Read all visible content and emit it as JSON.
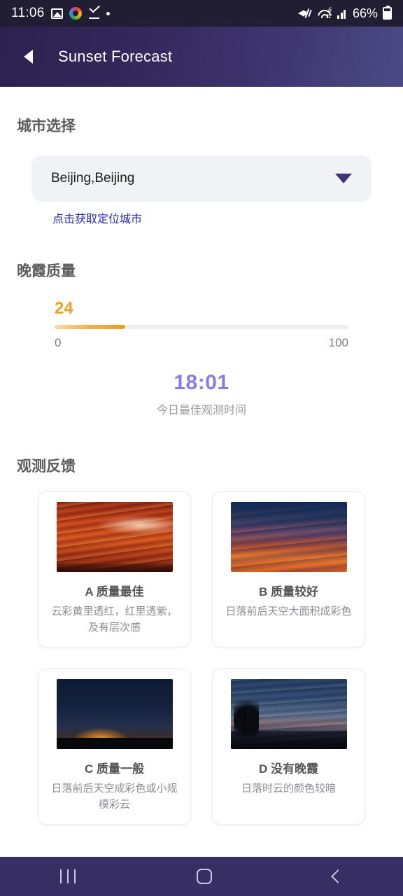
{
  "statusbar": {
    "time": "11:06",
    "battery_percent": "66%",
    "icons_left": [
      "photos-icon",
      "chrome-icon",
      "check-icon",
      "dot-icon"
    ],
    "icons_right": [
      "mute-icon",
      "wifi-icon",
      "signal-icon",
      "battery-icon"
    ]
  },
  "appbar": {
    "back_label": "",
    "title": "Sunset Forecast"
  },
  "city_section": {
    "heading": "城市选择",
    "selected_city": "Beijing,Beijing",
    "locate_link": "点击获取定位城市"
  },
  "quality_section": {
    "heading": "晚霞质量",
    "value": "24",
    "value_number": 24,
    "scale_min": "0",
    "scale_max": "100",
    "fill_percent": 24,
    "accent_color": "#f0a020"
  },
  "best_time": {
    "value": "18:01",
    "label": "今日最佳观测时间",
    "color": "#8a7ce8"
  },
  "feedback_section": {
    "heading": "观测反馈",
    "cards": [
      {
        "grade": "A 质量最佳",
        "desc": "云彩黄里透红，红里透紫，及有层次感",
        "image": "sunset-red-clouds"
      },
      {
        "grade": "B 质量较好",
        "desc": "日落前后天空大面积成彩色",
        "image": "sunset-blue-orange-clouds"
      },
      {
        "grade": "C 质量一般",
        "desc": "日落前后天空成彩色或小规模彩云",
        "image": "sunset-dark-horizon-glow"
      },
      {
        "grade": "D 没有晚霞",
        "desc": "日落时云的颜色较暗",
        "image": "dusk-dark-blue-tree"
      }
    ]
  },
  "navbar": {
    "recents": "recents-icon",
    "home": "home-icon",
    "back": "back-icon"
  }
}
